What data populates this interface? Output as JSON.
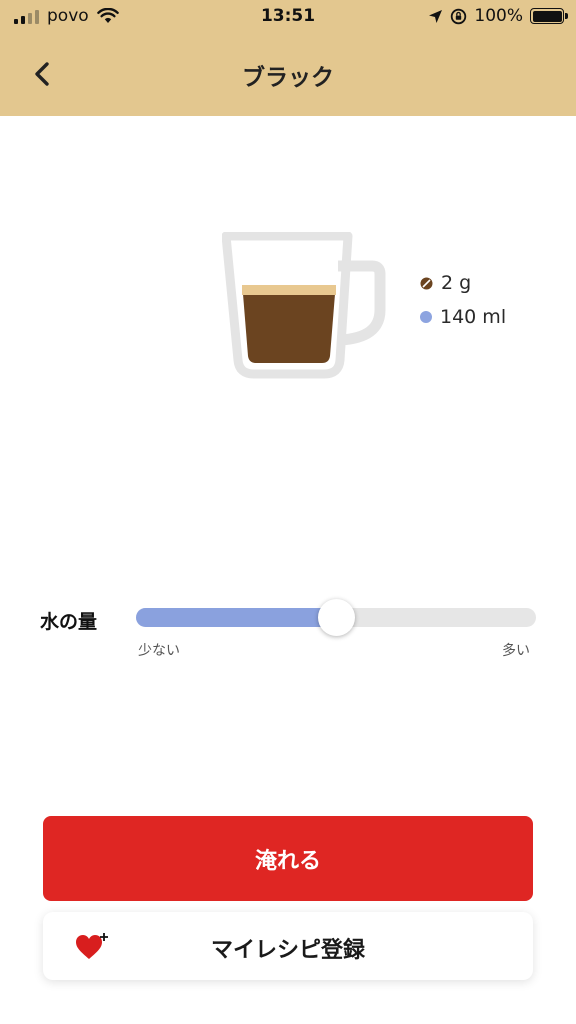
{
  "status_bar": {
    "carrier": "povo",
    "time": "13:51",
    "battery": "100%"
  },
  "nav": {
    "title": "ブラック",
    "back_icon": "chevron-left-icon"
  },
  "recipe": {
    "beans_amount": "2 g",
    "water_amount": "140 ml",
    "colors": {
      "coffee": "#6b4420",
      "crema": "#e8c890",
      "water_dot": "#8da4e0",
      "beans_dot": "#6b4420",
      "cup": "#e4e4e4"
    }
  },
  "slider": {
    "label": "水の量",
    "min_label": "少ない",
    "max_label": "多い",
    "value_fraction": 0.5,
    "fill_color": "#8aa1de"
  },
  "actions": {
    "brew_label": "淹れる",
    "my_recipe_label": "マイレシピ登録",
    "brew_color": "#df2623",
    "heart_icon": "heart-plus-icon",
    "heart_color": "#d81e1e"
  },
  "theme": {
    "header_bg": "#e3c78f"
  }
}
